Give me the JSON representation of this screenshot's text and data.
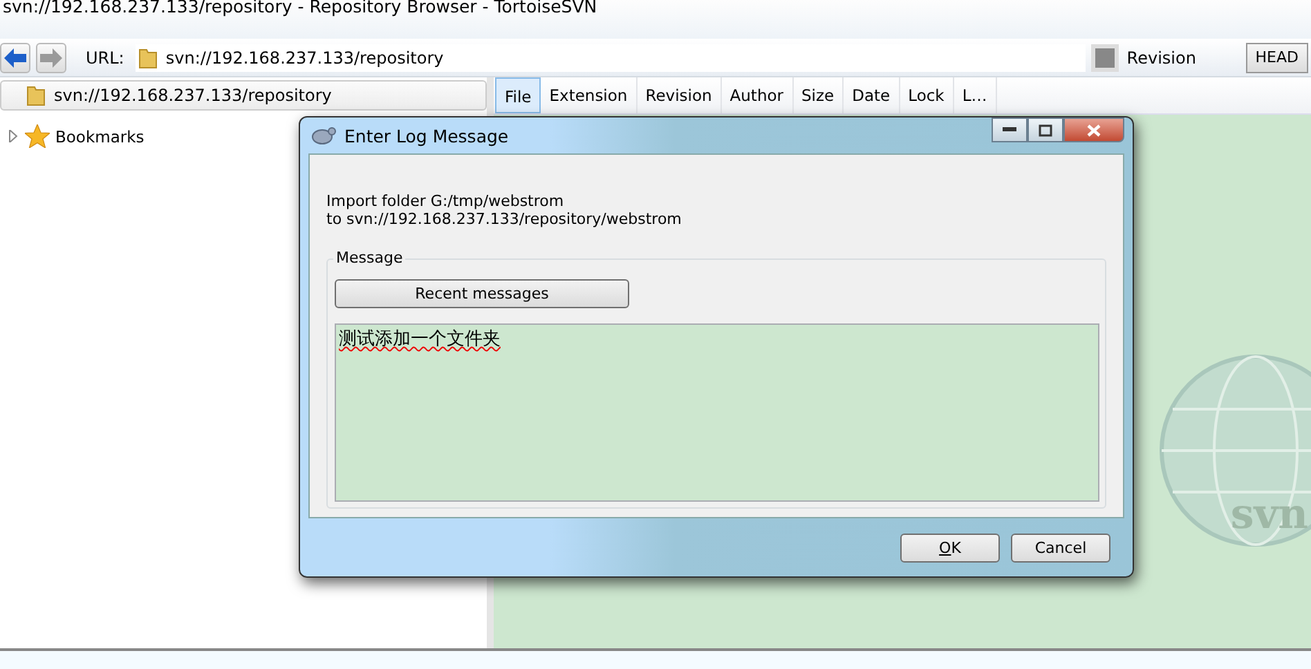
{
  "window": {
    "title": "svn://192.168.237.133/repository - Repository Browser - TortoiseSVN"
  },
  "toolbar": {
    "url_label": "URL:",
    "url": "svn://192.168.237.133/repository",
    "revision_label": "Revision",
    "revision_button": "HEAD"
  },
  "tree": {
    "root": "svn://192.168.237.133/repository",
    "items": [
      {
        "label": "Bookmarks",
        "expanded": false
      }
    ]
  },
  "table": {
    "columns": [
      {
        "label": "File",
        "selected": true
      },
      {
        "label": "Extension",
        "selected": false
      },
      {
        "label": "Revision",
        "selected": false
      },
      {
        "label": "Author",
        "selected": false
      },
      {
        "label": "Size",
        "selected": false
      },
      {
        "label": "Date",
        "selected": false
      },
      {
        "label": "Lock",
        "selected": false
      },
      {
        "label": "L…",
        "selected": false
      }
    ]
  },
  "dialog": {
    "title": "Enter Log Message",
    "info_lines": [
      "Import folder G:/tmp/webstrom",
      "to svn://192.168.237.133/repository/webstrom"
    ],
    "group_label": "Message",
    "recent_button": "Recent messages",
    "message": "测试添加一个文件夹",
    "buttons": [
      {
        "label": "OK",
        "access_key_underlined": true
      },
      {
        "label": "Cancel",
        "access_key_underlined": false
      }
    ]
  },
  "watermark_logo": {
    "text": "svn"
  }
}
